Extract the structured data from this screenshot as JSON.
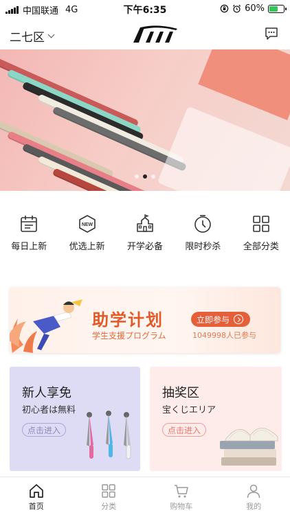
{
  "status_bar": {
    "carrier": "中国联通",
    "network": "4G",
    "time": "下午6:35",
    "battery": "60%",
    "battery_level": 0.6
  },
  "header": {
    "location": "二七区",
    "logo_alt": "logo",
    "message_icon": "chat-bubble-icon"
  },
  "banner": {
    "slide_count": 3,
    "active_slide": 2
  },
  "categories": [
    {
      "label": "每日上新",
      "icon": "calendar-icon"
    },
    {
      "label": "优选上新",
      "icon": "new-badge-icon"
    },
    {
      "label": "开学必备",
      "icon": "school-icon"
    },
    {
      "label": "限时秒杀",
      "icon": "timer-icon"
    },
    {
      "label": "全部分类",
      "icon": "grid-icon"
    }
  ],
  "study_plan": {
    "title": "助学计划",
    "subtitle": "学生支援プログラム",
    "button": "立即参与",
    "participants": "1049998人已参与"
  },
  "promo_cards": [
    {
      "title": "新人享免",
      "subtitle": "初心者は無料",
      "button": "点击进入"
    },
    {
      "title": "抽奖区",
      "subtitle": "宝くじエリア",
      "button": "点击进入"
    }
  ],
  "tabbar": [
    {
      "label": "首页",
      "icon": "home-icon",
      "active": true
    },
    {
      "label": "分类",
      "icon": "category-grid-icon",
      "active": false
    },
    {
      "label": "购物车",
      "icon": "cart-icon",
      "active": false
    },
    {
      "label": "我的",
      "icon": "user-icon",
      "active": false
    }
  ],
  "colors": {
    "accent": "#e4603a",
    "plan_title": "#e05a2a",
    "card_left_bg": "#dedcf5",
    "card_right_bg": "#fdecea"
  }
}
